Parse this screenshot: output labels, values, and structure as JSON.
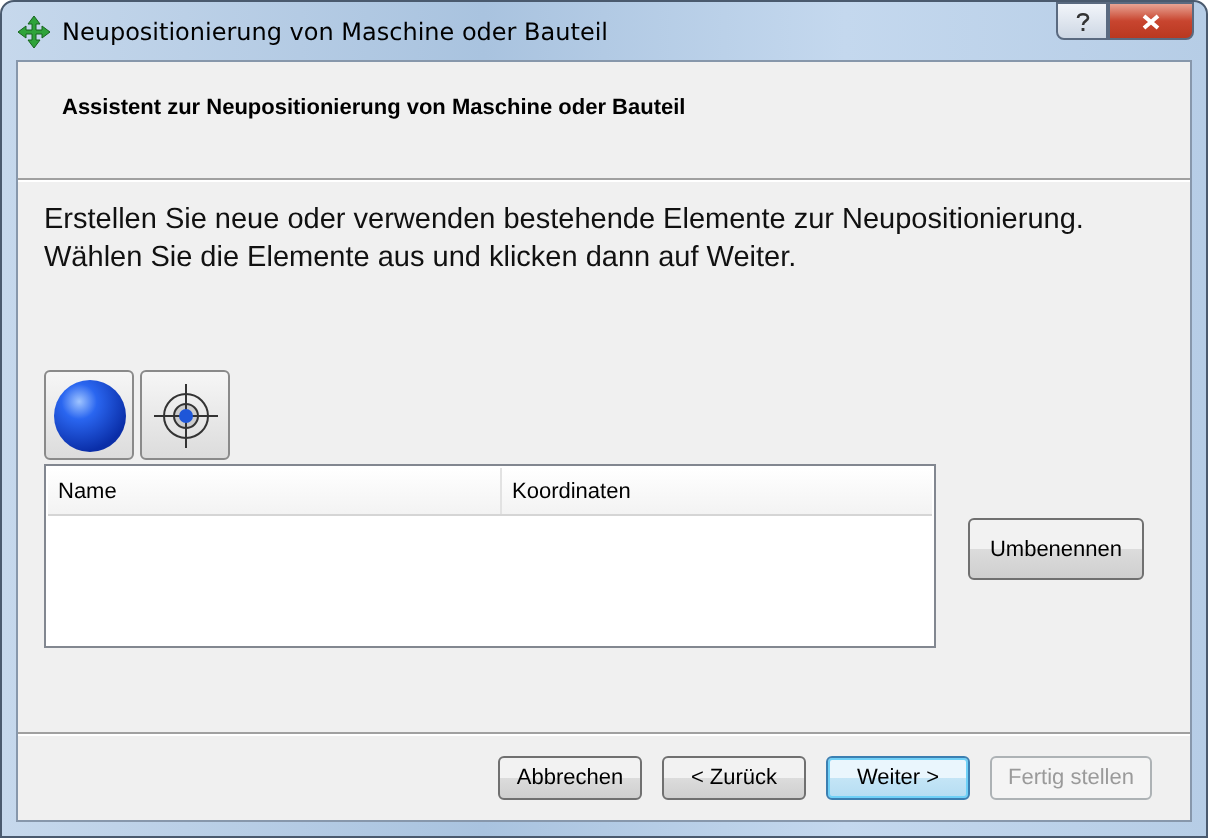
{
  "window": {
    "title": "Neupositionierung von Maschine oder Bauteil"
  },
  "header": {
    "title": "Assistent zur Neupositionierung von Maschine oder Bauteil"
  },
  "instructions": [
    "Erstellen Sie neue oder verwenden bestehende Elemente zur Neupositionierung.",
    "Wählen Sie die Elemente aus und klicken dann auf Weiter."
  ],
  "tools": [
    {
      "kind": "sphere"
    },
    {
      "kind": "target"
    }
  ],
  "table": {
    "columns": [
      "Name",
      "Koordinaten"
    ]
  },
  "side_button": "Umbenennen",
  "buttons": [
    {
      "label": "Abbrechen",
      "default": false,
      "disabled": false
    },
    {
      "label": "< Zurück",
      "default": false,
      "disabled": false
    },
    {
      "label": "Weiter >",
      "default": true,
      "disabled": false
    },
    {
      "label": "Fertig stellen",
      "default": false,
      "disabled": true
    }
  ]
}
